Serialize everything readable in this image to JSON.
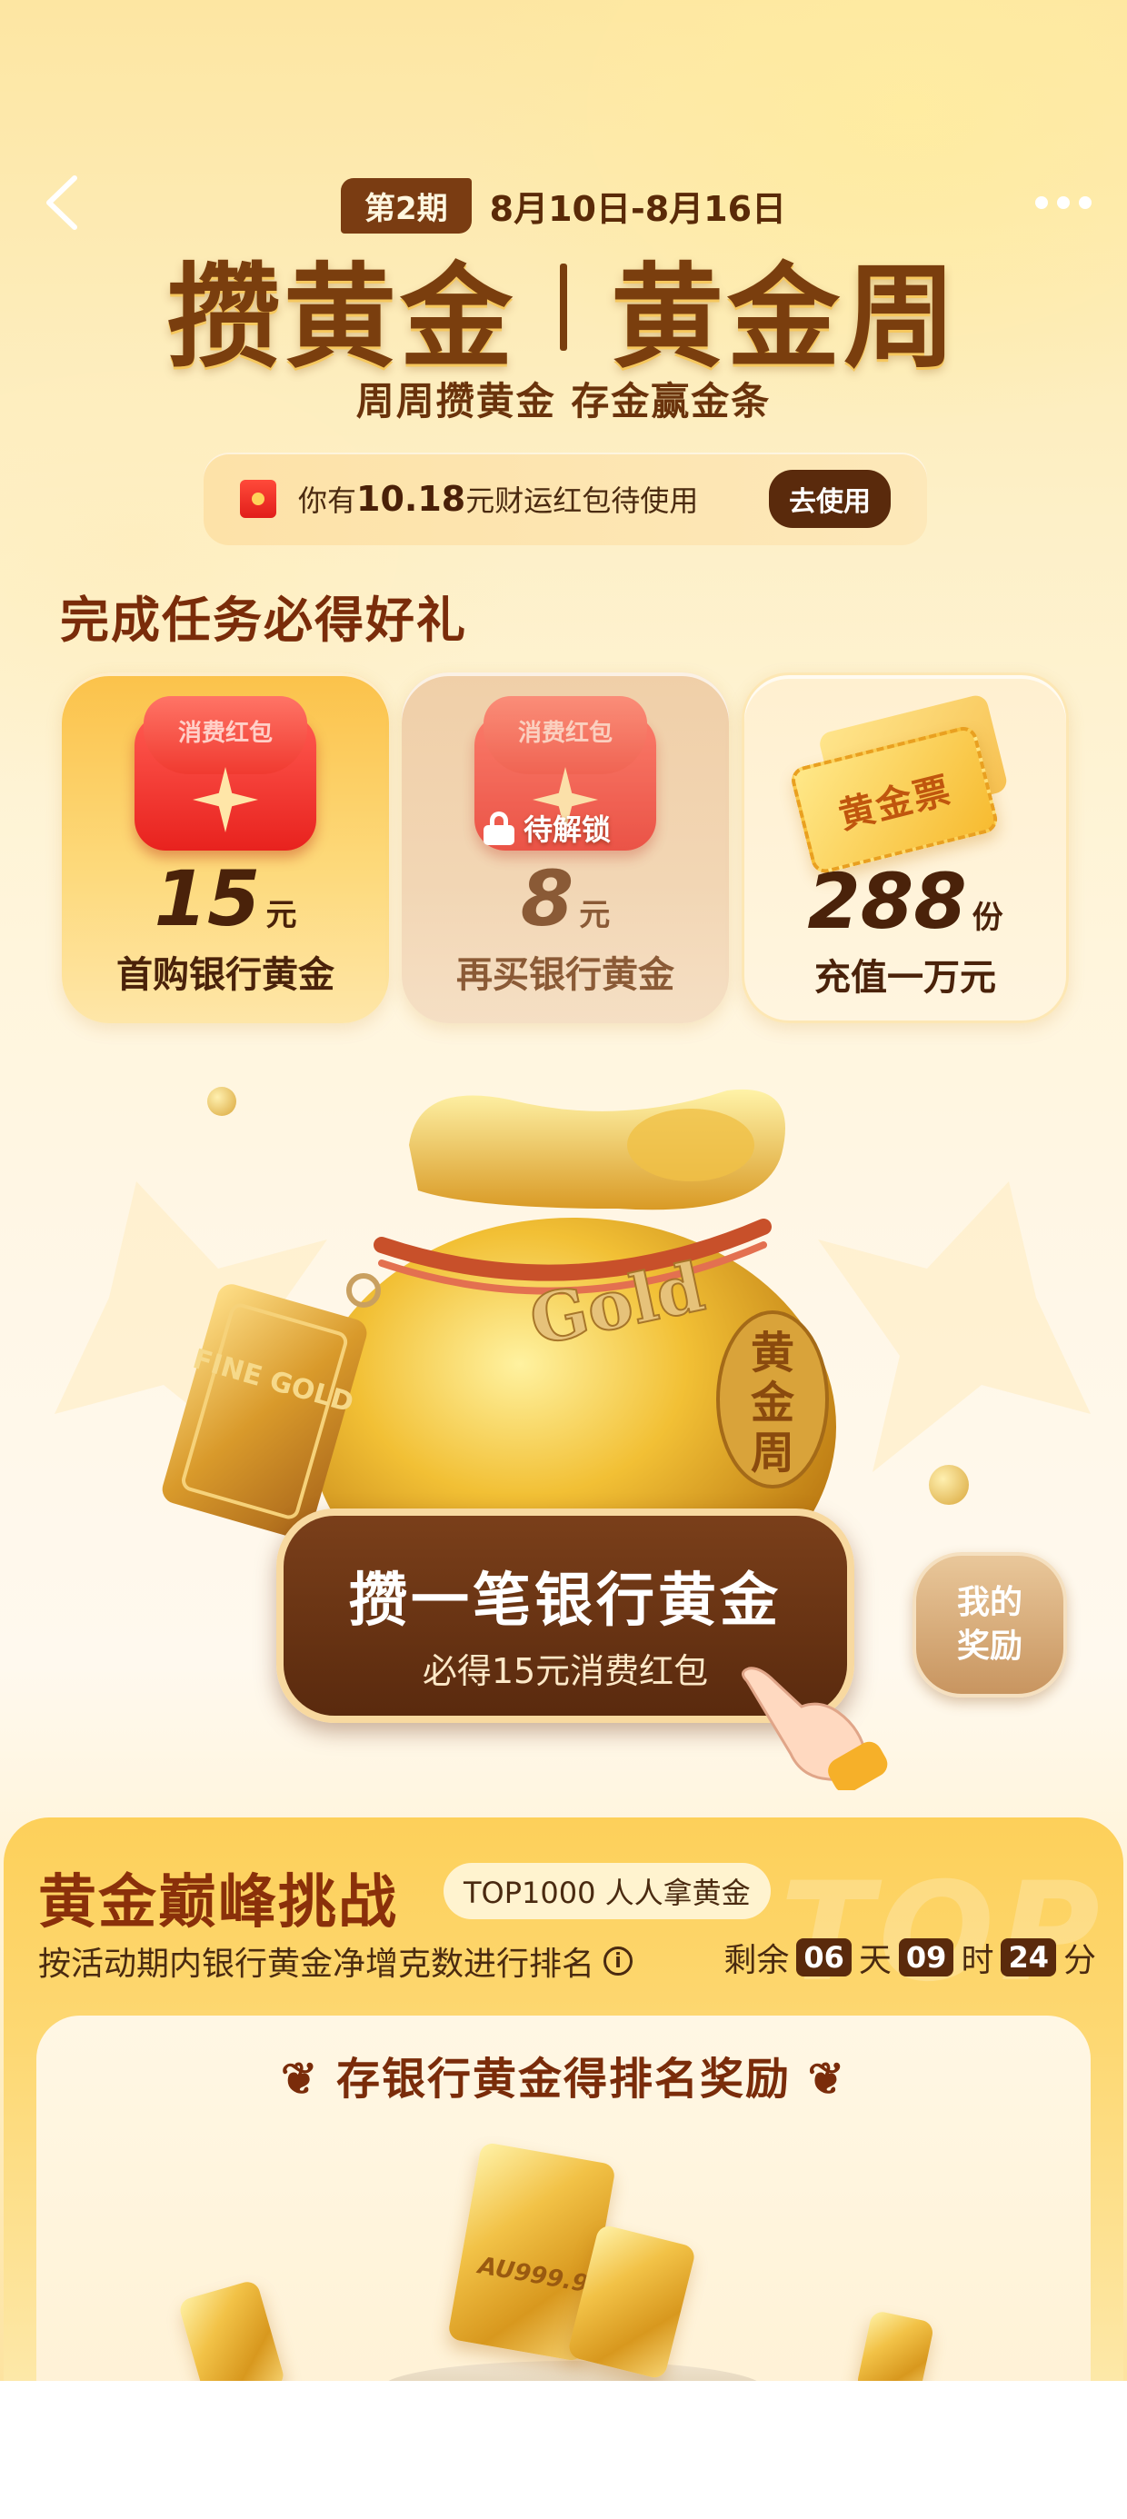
{
  "nav": {
    "back_icon": "chevron-left-icon",
    "more_icon": "more-dots-icon"
  },
  "header": {
    "period_badge": "第2期",
    "date_range": "8月10日-8月16日",
    "title_left": "攒黄金",
    "title_right": "黄金周",
    "subtitle": "周周攒黄金 存金赢金条"
  },
  "coupon": {
    "text_prefix": "你有",
    "amount": "10.18",
    "text_suffix": "元财运红包待使用",
    "button": "去使用"
  },
  "tasks": {
    "section_title": "完成任务必得好礼",
    "items": [
      {
        "badge": "消费红包",
        "amount": "15",
        "unit": "元",
        "desc": "首购银行黄金"
      },
      {
        "badge": "消费红包",
        "lock_label": "待解锁",
        "amount": "8",
        "unit": "元",
        "desc": "再买银行黄金"
      },
      {
        "badge": "黄金票",
        "amount": "288",
        "unit": "份",
        "desc": "充值一万元"
      }
    ]
  },
  "illustration": {
    "bag_text": "Gold",
    "bag_side_text": "黄金周",
    "bar_text": "FINE GOLD"
  },
  "cta": {
    "title": "攒一笔银行黄金",
    "subtitle": "必得15元消费红包"
  },
  "reward_button": {
    "line1": "我的",
    "line2": "奖励"
  },
  "challenge": {
    "title": "黄金巅峰挑战",
    "tag": "TOP1000 人人拿黄金",
    "watermark": "TOP",
    "description": "按活动期内银行黄金净增克数进行排名",
    "countdown_prefix": "剩余",
    "days": "06",
    "days_unit": "天",
    "hours": "09",
    "hours_unit": "时",
    "minutes": "24",
    "minutes_unit": "分",
    "rank_title": "存银行黄金得排名奖励",
    "bar_stamp": "AU999.9"
  },
  "colors": {
    "brand_brown": "#5a2a0c",
    "gold": "#f2c247",
    "red_packet": "#e8221e"
  }
}
